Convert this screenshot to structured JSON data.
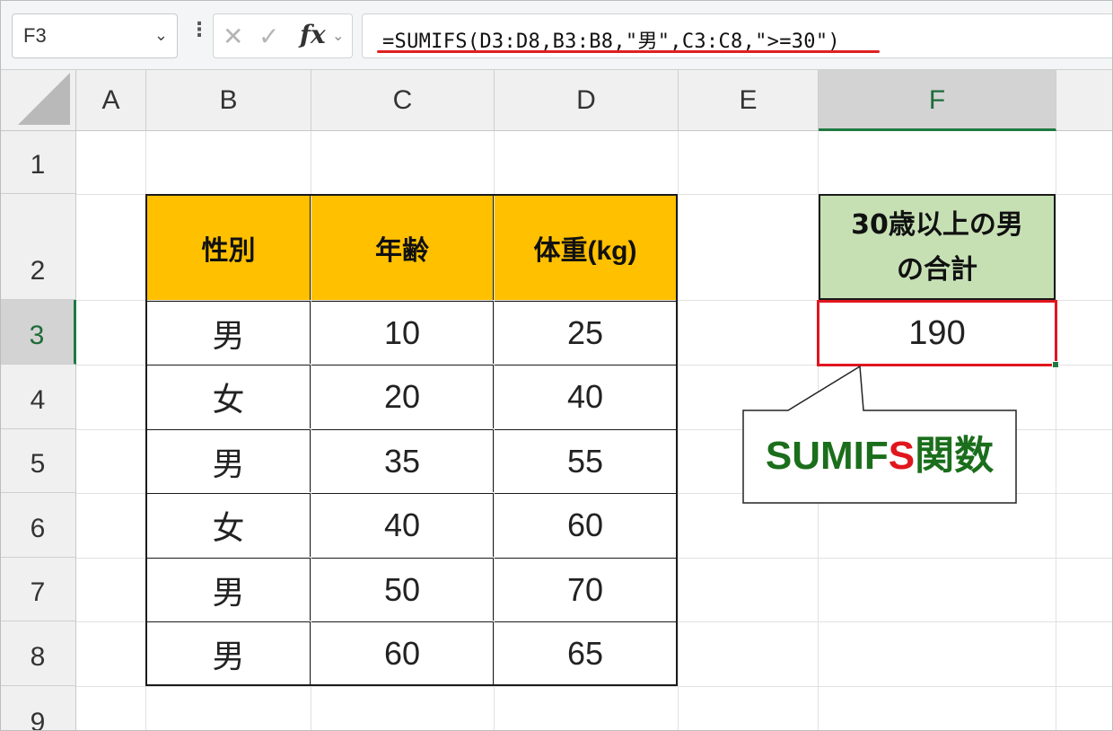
{
  "formula_bar": {
    "name_box": "F3",
    "name_box_arrow": "⌄",
    "dots": "⋮",
    "cancel_symbol": "✕",
    "enter_symbol": "✓",
    "fx_label": "fx",
    "fx_dropdown": "⌄",
    "formula": "=SUMIFS(D3:D8,B3:B8,\"男\",C3:C8,\">=30\")"
  },
  "columns": [
    "A",
    "B",
    "C",
    "D",
    "E",
    "F"
  ],
  "rows": [
    "1",
    "2",
    "3",
    "4",
    "5",
    "6",
    "7",
    "8",
    "9"
  ],
  "table": {
    "headers": [
      "性別",
      "年齢",
      "体重(kg)"
    ],
    "rows": [
      [
        "男",
        "10",
        "25"
      ],
      [
        "女",
        "20",
        "40"
      ],
      [
        "男",
        "35",
        "55"
      ],
      [
        "女",
        "40",
        "60"
      ],
      [
        "男",
        "50",
        "70"
      ],
      [
        "男",
        "60",
        "65"
      ]
    ]
  },
  "result": {
    "header_line1": "30歳以上の男",
    "header_line2": "の合計",
    "value": "190"
  },
  "callout": {
    "text_green_1": "SUMIF",
    "text_red": "S",
    "text_green_2": "関数"
  },
  "colors": {
    "header_fill": "#ffc000",
    "result_header_fill": "#c6e0b4",
    "highlight_red": "#e0161e",
    "excel_green": "#1f7a43"
  }
}
